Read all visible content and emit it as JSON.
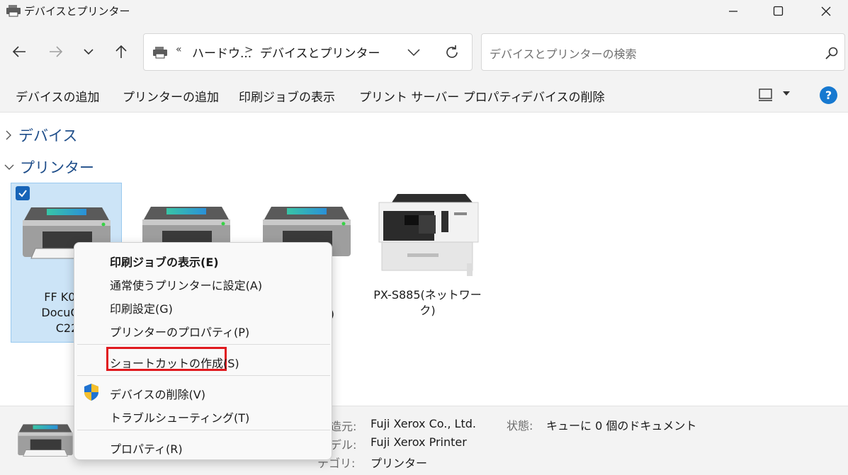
{
  "window": {
    "title": "デバイスとプリンター"
  },
  "nav": {
    "breadcrumb_prefix": "«",
    "breadcrumb_parent": "ハードウ...",
    "breadcrumb_sep": ">",
    "breadcrumb_current": "デバイスとプリンター",
    "search_placeholder": "デバイスとプリンターの検索"
  },
  "commands": {
    "add_device": "デバイスの追加",
    "add_printer": "プリンターの追加",
    "see_print_jobs": "印刷ジョブの表示",
    "print_server_properties": "プリント サーバー プロパティ",
    "remove_device": "デバイスの削除",
    "help": "?"
  },
  "groups": {
    "devices": "デバイス",
    "printers": "プリンター"
  },
  "printers": [
    {
      "label_line1": "FF K063",
      "label_line2": "DocuCen",
      "label_line3": "C22",
      "selected": true
    },
    {
      "label_line1": "",
      "label_line2": "",
      "label_line3": ""
    },
    {
      "label_line1": "",
      "label_line2": ")",
      "label_line3": ""
    },
    {
      "label_line1": "PX-S885(ネットワー",
      "label_line2": "ク)",
      "label_line3": ""
    }
  ],
  "context_menu": {
    "items": [
      "印刷ジョブの表示(E)",
      "通常使うプリンターに設定(A)",
      "印刷設定(G)",
      "プリンターのプロパティ(P)",
      "ショートカットの作成(S)",
      "デバイスの削除(V)",
      "トラブルシューティング(T)",
      "プロパティ(R)"
    ]
  },
  "details": {
    "manufacturer_label": "造元:",
    "manufacturer_value": "Fuji Xerox Co., Ltd.",
    "model_label": "デル:",
    "model_value": "Fuji Xerox Printer",
    "category_label": "テゴリ:",
    "category_value": "プリンター",
    "status_label": "状態:",
    "status_value": "キューに 0 個のドキュメント"
  },
  "colors": {
    "accent": "#1764b8",
    "highlight_box": "#e0191e",
    "selected_tile": "#cce4f7"
  }
}
